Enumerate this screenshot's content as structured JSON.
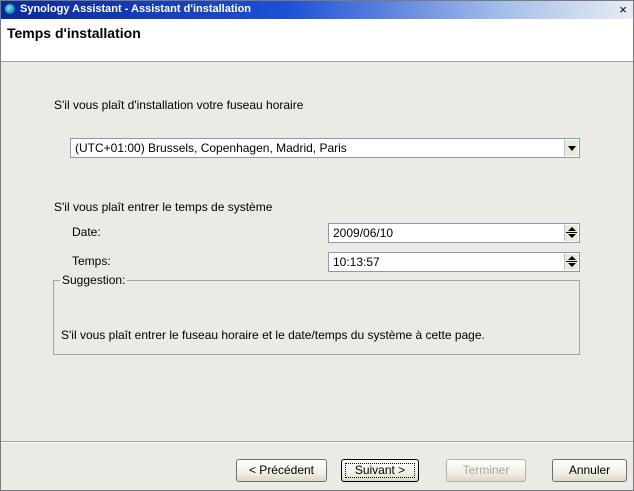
{
  "window": {
    "title": "Synology Assistant - Assistant d'installation",
    "close_glyph": "×"
  },
  "header": {
    "page_title": "Temps d'installation"
  },
  "timezone": {
    "prompt": "S'il vous plaît d'installation votre fuseau horaire",
    "selected": "(UTC+01:00) Brussels, Copenhagen, Madrid, Paris"
  },
  "system_time": {
    "prompt": "S'il vous plaît entrer le temps de système",
    "date_label": "Date:",
    "date_value": "2009/06/10",
    "time_label": "Temps:",
    "time_value": "10:13:57"
  },
  "suggestion": {
    "legend": "Suggestion:",
    "text": "S'il vous plaît entrer le fuseau horaire et le date/temps du système à cette page."
  },
  "buttons": {
    "previous": "< Précédent",
    "next": "Suivant >",
    "finish": "Terminer",
    "cancel": "Annuler"
  }
}
